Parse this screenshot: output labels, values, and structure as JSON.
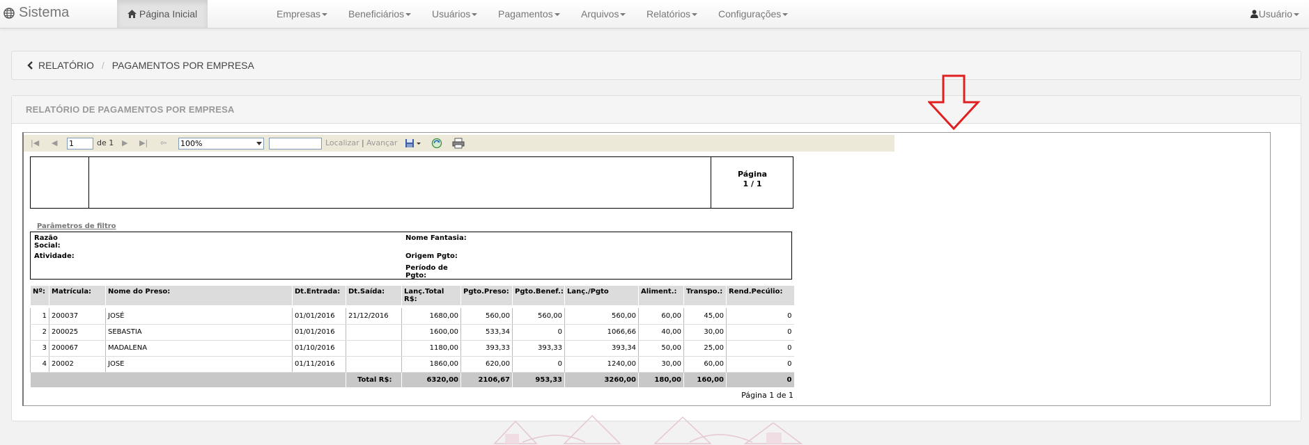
{
  "navbar": {
    "brand": "Sistema",
    "home": "Página Inicial",
    "menus": [
      "Empresas",
      "Beneficiários",
      "Usuários",
      "Pagamentos",
      "Arquivos",
      "Relatórios",
      "Configurações"
    ],
    "user": "Usuário"
  },
  "breadcrumb": {
    "parent": "RELATÓRIO",
    "separator": "/",
    "current": "PAGAMENTOS POR EMPRESA"
  },
  "panel": {
    "title": "RELATÓRIO DE PAGAMENTOS POR EMPRESA"
  },
  "toolbar": {
    "page_value": "1",
    "of_label": "de 1",
    "zoom": "100%",
    "find_label": "Localizar",
    "divider": "|",
    "next_label": "Avançar"
  },
  "report": {
    "page_label_1": "Página",
    "page_label_2": "1 / 1",
    "filter_title": "Parâmetros de filtro",
    "filters": {
      "razao_social_1": "Razão",
      "razao_social_2": "Social:",
      "atividade": "Atividade:",
      "nome_fantasia": "Nome Fantasia:",
      "origem_pgto": "Origem Pgto:",
      "periodo_1": "Período de",
      "periodo_2": "Pgto:"
    },
    "columns": [
      "Nº:",
      "Matrícula:",
      "Nome do Preso:",
      "Dt.Entrada:",
      "Dt.Saída:",
      "Lanç.Total R$:",
      "Pgto.Preso:",
      "Pgto.Benef.:",
      "Lanç./Pgto",
      "Aliment.:",
      "Transpo.:",
      "Rend.Pecúlio:"
    ],
    "rows": [
      [
        "1",
        "200037",
        "JOSÉ ",
        "01/01/2016",
        "21/12/2016",
        "1680,00",
        "560,00",
        "560,00",
        "560,00",
        "60,00",
        "45,00",
        "0"
      ],
      [
        "2",
        "200025",
        "SEBASTIA",
        "01/01/2016",
        "",
        "1600,00",
        "533,34",
        "0",
        "1066,66",
        "40,00",
        "30,00",
        "0"
      ],
      [
        "3",
        "200067",
        "MADALENA",
        "01/10/2016",
        "",
        "1180,00",
        "393,33",
        "393,33",
        "393,34",
        "50,00",
        "25,00",
        "0"
      ],
      [
        "4",
        "20002",
        "JOSE",
        "01/11/2016",
        "",
        "1860,00",
        "620,00",
        "0",
        "1240,00",
        "30,00",
        "60,00",
        "0"
      ]
    ],
    "total_label": "Total R$:",
    "totals": [
      "6320,00",
      "2106,67",
      "953,33",
      "3260,00",
      "180,00",
      "160,00",
      "0"
    ],
    "footer": "Página 1 de 1"
  },
  "colors": {
    "annotation_arrow": "#e02020",
    "toolbar_bg": "#ece9d8",
    "header_bg": "#dcdcdc",
    "total_bg": "#c8c8c8"
  },
  "icons": [
    "globe-icon",
    "home-icon",
    "chevron-left-icon",
    "user-icon",
    "first-page-icon",
    "prev-page-icon",
    "next-page-icon",
    "last-page-icon",
    "back-icon",
    "export-icon",
    "refresh-icon",
    "print-icon",
    "down-arrow-annotation"
  ]
}
